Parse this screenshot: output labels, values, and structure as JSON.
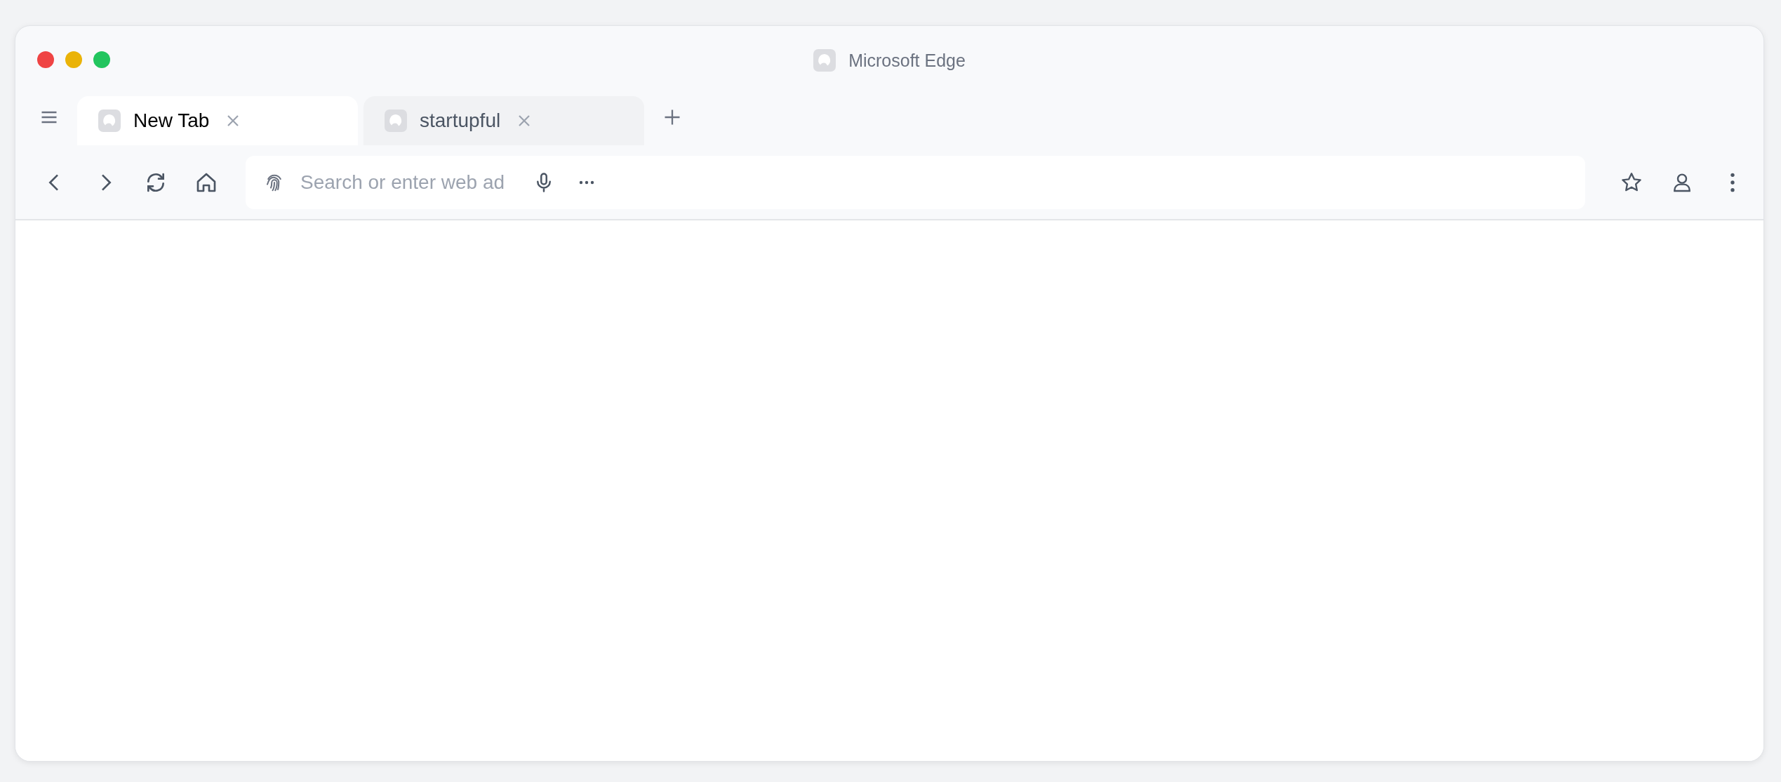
{
  "window": {
    "title": "Microsoft Edge"
  },
  "tabs": [
    {
      "label": "New Tab",
      "selected": true
    },
    {
      "label": "startupful",
      "selected": false
    }
  ],
  "address_bar": {
    "placeholder": "Search or enter web ad"
  }
}
